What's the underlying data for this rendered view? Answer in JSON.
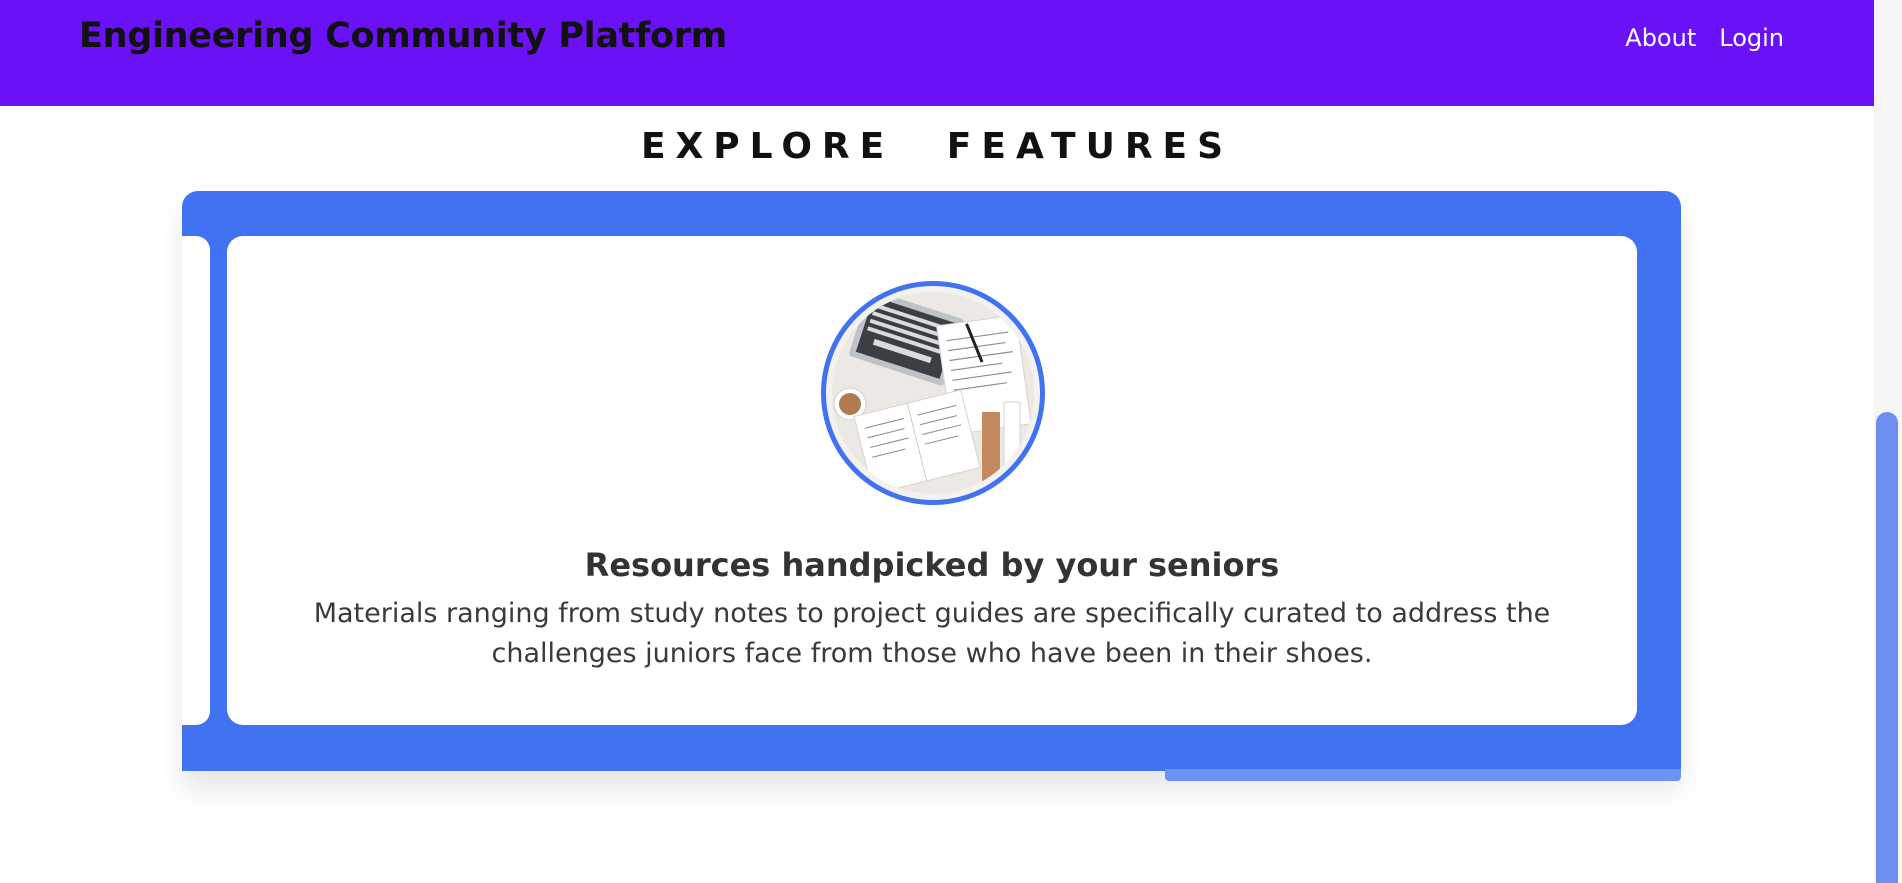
{
  "header": {
    "brand": "Engineering Community Platform",
    "nav": [
      {
        "label": "About"
      },
      {
        "label": "Login"
      }
    ]
  },
  "section": {
    "title": "EXPLORE FEATURES"
  },
  "carousel": {
    "active_card": {
      "image_icon": "study-desk-photo",
      "title": "Resources handpicked by your seniors",
      "description": "Materials ranging from study notes to project guides are specifically curated to address the challenges juniors face from those who have been in their shoes."
    }
  },
  "colors": {
    "navbar": "#6a11f5",
    "carousel": "#4172f2",
    "scroll_thumb": "#6b93f5"
  }
}
